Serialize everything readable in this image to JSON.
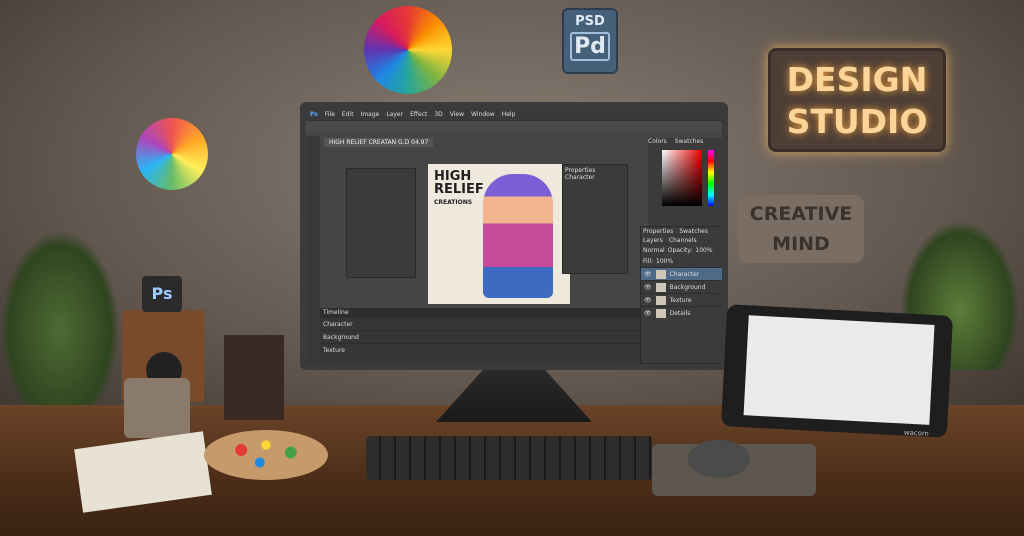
{
  "wall": {
    "sign": {
      "line1": "DESIGN",
      "line2": "STUDIO",
      "glow_color": "#f0a040"
    },
    "plaque": {
      "line1": "CREATIVE",
      "line2": "MIND"
    },
    "psd_icon": {
      "top": "PSD",
      "bottom": "Pd"
    },
    "ps_icon": "Ps"
  },
  "monitor": {
    "menu": [
      "Ps",
      "File",
      "Edit",
      "Image",
      "Layer",
      "Effect",
      "3D",
      "View",
      "Window",
      "Help"
    ],
    "document_tab": "HIGH RELIEF CREATAN G.D 04.97",
    "canvas_title": {
      "line1": "HIGH",
      "line2": "RELIEF",
      "line3": "CREATIONS"
    },
    "panels": {
      "top_tabs": [
        "Colors",
        "Swatches"
      ],
      "side_tabs": [
        "Properties",
        "Swatches"
      ],
      "layer_tabs": [
        "Layers",
        "Channels"
      ],
      "blend_mode": "Normal",
      "opacity_label": "Opacity:",
      "opacity": "100%",
      "fill_label": "Fill:",
      "fill": "100%",
      "layers": [
        {
          "name": "Character",
          "selected": true
        },
        {
          "name": "Background",
          "selected": false
        },
        {
          "name": "Texture",
          "selected": false
        },
        {
          "name": "Details",
          "selected": false
        }
      ],
      "properties_title": "Properties",
      "properties_sub": "Character"
    },
    "timeline": {
      "title": "Timeline",
      "tracks": [
        "Character",
        "Background",
        "Texture"
      ]
    }
  },
  "tablet": {
    "brand": "wacom"
  }
}
